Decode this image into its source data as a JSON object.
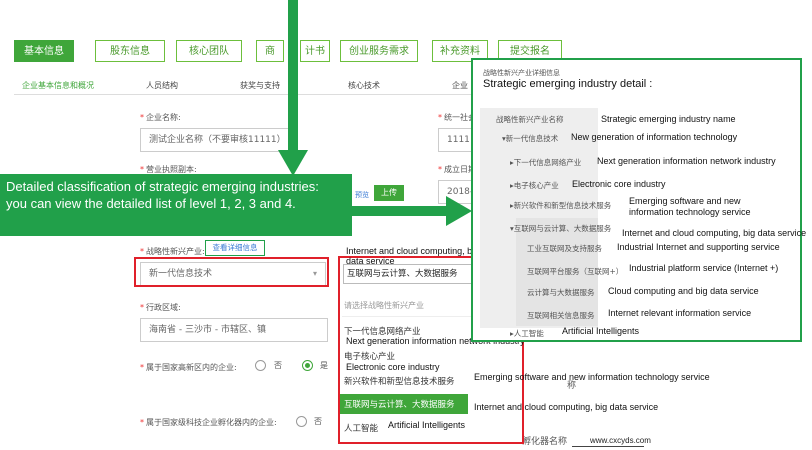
{
  "main_tabs": [
    "基本信息",
    "股东信息",
    "核心团队",
    "商",
    "计书",
    "创业服务需求",
    "补充资料",
    "提交报名"
  ],
  "sub_tabs": [
    "企业基本信息和概况",
    "人员结构",
    "获奖与支持",
    "核心技术",
    "企业"
  ],
  "form": {
    "company_name_label": "企业名称:",
    "company_name_value": "测试企业名称（不要审核11111）",
    "credit_code_label": "统一社会",
    "credit_code_value": "1111",
    "license_label": "营业执照副本:",
    "founded_label": "成立日期",
    "founded_value": "2018-",
    "upload_label": "上传",
    "preview_label": "预览",
    "industry_label": "战略性新兴产业:",
    "view_detail_link": "查看详细信息",
    "industry_value": "新一代信息技术",
    "region_label": "行政区域:",
    "region_value": "海南省 - 三沙市 - 市辖区、镇",
    "hightech_zone_label": "属于国家高新区内的企业:",
    "no_label": "否",
    "yes_label": "是",
    "incubator_label": "属于国家级科技企业孵化器内的企业:",
    "no_label2": "否"
  },
  "dropdown": {
    "selected": "互联网与云计算、大数据服务",
    "selected_en": "Internet and cloud computing, big data service",
    "placeholder": "请选择战略性新兴产业",
    "options": [
      {
        "cn": "下一代信息网络产业",
        "en": "Next generation information network industry"
      },
      {
        "cn": "电子核心产业",
        "en": "Electronic core industry"
      },
      {
        "cn": "新兴软件和新型信息技术服务",
        "en": "Emerging software and new information technology service"
      },
      {
        "cn": "互联网与云计算、大数据服务",
        "en": "Internet and cloud computing, big data service"
      },
      {
        "cn": "人工智能",
        "en": "Artificial Intelligents"
      }
    ],
    "behind_text_1": "称",
    "behind_text_2": "孵化器名称"
  },
  "detail_panel": {
    "cn_title": "战略性新兴产业详细信息",
    "en_title": "Strategic emerging industry detail :",
    "rows": [
      {
        "cn": "战略性新兴产业名称",
        "en": "Strategic emerging industry name"
      },
      {
        "cn": "▾新一代信息技术",
        "en": "New generation of information technology"
      },
      {
        "cn": "▸下一代信息网络产业",
        "en": "Next generation information network industry"
      },
      {
        "cn": "▸电子核心产业",
        "en": "Electronic core industry"
      },
      {
        "cn": "▸新兴软件和新型信息技术服务",
        "en": "Emerging software and new information technology service"
      },
      {
        "cn": "▾互联网与云计算、大数据服务",
        "en": "Internet and cloud computing, big data service"
      },
      {
        "cn": "工业互联网及支持服务",
        "en": "Industrial Internet and supporting service"
      },
      {
        "cn": "互联网平台服务（互联网+）",
        "en": "Industrial platform service (Internet +)"
      },
      {
        "cn": "云计算与大数据服务",
        "en": "Cloud computing and big data service"
      },
      {
        "cn": "互联网相关信息服务",
        "en": "Internet relevant information service"
      },
      {
        "cn": "▸人工智能",
        "en": "Artificial Intelligents"
      }
    ]
  },
  "callout": {
    "text": "Detailed classification of strategic emerging industries: you can view the detailed list of level 1, 2, 3 and 4."
  },
  "watermark": "www.cxcyds.com",
  "colors": {
    "accent_green": "#3fa63a",
    "callout_green": "#21a04a",
    "highlight_red": "#e0202a"
  }
}
